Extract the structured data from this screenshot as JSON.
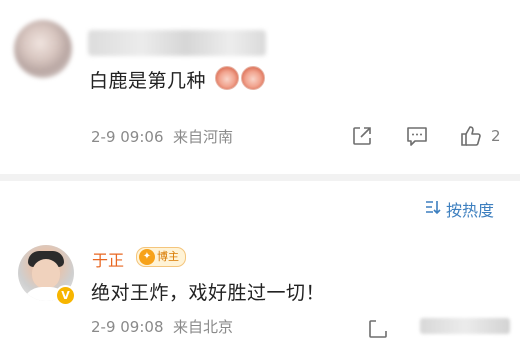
{
  "comments": [
    {
      "text": "白鹿是第几种",
      "time": "2-9 09:06",
      "location": "来自河南",
      "like_count": "2",
      "icons": [
        "share-icon",
        "comment-icon",
        "like-icon"
      ]
    },
    {
      "author": "于正",
      "badge": "博主",
      "verified_badge": "V",
      "text": "绝对王炸，戏好胜过一切！",
      "time": "2-9 09:08",
      "location": "来自北京"
    }
  ],
  "sort": {
    "label": "按热度"
  },
  "colors": {
    "link_blue": "#3d7fbf",
    "author_orange": "#e86722",
    "meta_gray": "#8a8a8a"
  }
}
